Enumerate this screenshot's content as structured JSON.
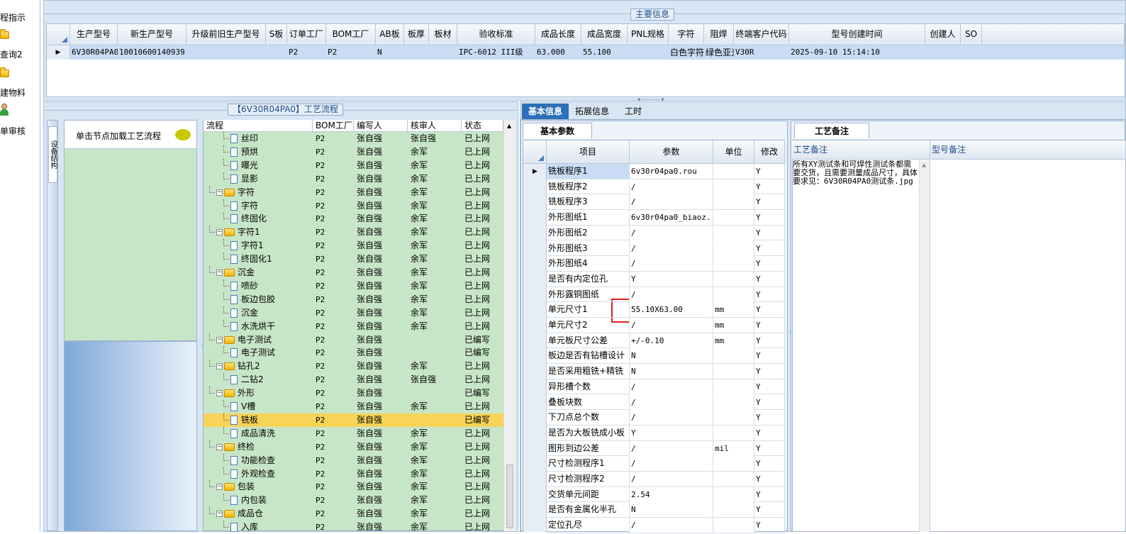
{
  "left_nav": [
    {
      "label": "程指示",
      "icon": "none"
    },
    {
      "label": "查询2",
      "icon": "folder-icon"
    },
    {
      "label": "建物料",
      "icon": "folder-icon"
    },
    {
      "label": "单审核",
      "icon": "user-icon"
    }
  ],
  "main_info": {
    "legend": "主要信息",
    "columns": [
      "生产型号",
      "新生产型号",
      "升级前旧生产型号",
      "S板",
      "订单工厂",
      "BOM工厂",
      "AB板",
      "板厚",
      "板材",
      "验收标准",
      "成品长度",
      "成品宽度",
      "PNL规格",
      "字符",
      "阻焊",
      "终端客户代码",
      "型号创建时间",
      "创建人",
      "SO"
    ],
    "row": [
      "6V30R04PA0",
      "10010600140939",
      "",
      "",
      "P2",
      "P2",
      "N",
      "",
      "",
      "IPC-6012 III级",
      "63.000",
      "55.100",
      "",
      "白色字符",
      "绿色亚光",
      "V30R",
      "2025-09-10 15:14:10",
      "",
      ""
    ]
  },
  "flow": {
    "legend": "【6V30R04PA0】工艺流程",
    "side_tab": "设备结构",
    "hint": "单击节点加载工艺流程",
    "columns": [
      "流程",
      "BOM工厂",
      "编写人",
      "核审人",
      "状态"
    ],
    "rows": [
      {
        "level": 2,
        "type": "file",
        "name": "丝印",
        "factory": "P2",
        "writer": "张自强",
        "reviewer": "张自强",
        "status": "已上网"
      },
      {
        "level": 2,
        "type": "file",
        "name": "预烘",
        "factory": "P2",
        "writer": "张自强",
        "reviewer": "余军",
        "status": "已上网"
      },
      {
        "level": 2,
        "type": "file",
        "name": "曝光",
        "factory": "P2",
        "writer": "张自强",
        "reviewer": "余军",
        "status": "已上网"
      },
      {
        "level": 2,
        "type": "file",
        "name": "显影",
        "factory": "P2",
        "writer": "张自强",
        "reviewer": "余军",
        "status": "已上网"
      },
      {
        "level": 1,
        "type": "folder",
        "name": "字符",
        "factory": "P2",
        "writer": "张自强",
        "reviewer": "余军",
        "status": "已上网"
      },
      {
        "level": 2,
        "type": "file",
        "name": "字符",
        "factory": "P2",
        "writer": "张自强",
        "reviewer": "余军",
        "status": "已上网"
      },
      {
        "level": 2,
        "type": "file",
        "name": "终固化",
        "factory": "P2",
        "writer": "张自强",
        "reviewer": "余军",
        "status": "已上网"
      },
      {
        "level": 1,
        "type": "folder",
        "name": "字符1",
        "factory": "P2",
        "writer": "张自强",
        "reviewer": "余军",
        "status": "已上网"
      },
      {
        "level": 2,
        "type": "file",
        "name": "字符1",
        "factory": "P2",
        "writer": "张自强",
        "reviewer": "余军",
        "status": "已上网"
      },
      {
        "level": 2,
        "type": "file",
        "name": "终固化1",
        "factory": "P2",
        "writer": "张自强",
        "reviewer": "余军",
        "status": "已上网"
      },
      {
        "level": 1,
        "type": "folder",
        "name": "沉金",
        "factory": "P2",
        "writer": "张自强",
        "reviewer": "余军",
        "status": "已上网"
      },
      {
        "level": 2,
        "type": "file",
        "name": "喷砂",
        "factory": "P2",
        "writer": "张自强",
        "reviewer": "余军",
        "status": "已上网"
      },
      {
        "level": 2,
        "type": "file",
        "name": "板边包胶",
        "factory": "P2",
        "writer": "张自强",
        "reviewer": "余军",
        "status": "已上网"
      },
      {
        "level": 2,
        "type": "file",
        "name": "沉金",
        "factory": "P2",
        "writer": "张自强",
        "reviewer": "余军",
        "status": "已上网"
      },
      {
        "level": 2,
        "type": "file",
        "name": "水洗烘干",
        "factory": "P2",
        "writer": "张自强",
        "reviewer": "余军",
        "status": "已上网"
      },
      {
        "level": 1,
        "type": "folder",
        "name": "电子测试",
        "factory": "P2",
        "writer": "张自强",
        "reviewer": "",
        "status": "已编写"
      },
      {
        "level": 2,
        "type": "file",
        "name": "电子测试",
        "factory": "P2",
        "writer": "张自强",
        "reviewer": "",
        "status": "已编写"
      },
      {
        "level": 1,
        "type": "folder",
        "name": "钻孔2",
        "factory": "P2",
        "writer": "张自强",
        "reviewer": "余军",
        "status": "已上网"
      },
      {
        "level": 2,
        "type": "file",
        "name": "二钻2",
        "factory": "P2",
        "writer": "张自强",
        "reviewer": "张自强",
        "status": "已上网"
      },
      {
        "level": 1,
        "type": "folder",
        "name": "外形",
        "factory": "P2",
        "writer": "张自强",
        "reviewer": "",
        "status": "已编写"
      },
      {
        "level": 2,
        "type": "file",
        "name": "V槽",
        "factory": "P2",
        "writer": "张自强",
        "reviewer": "余军",
        "status": "已上网"
      },
      {
        "level": 2,
        "type": "file",
        "name": "铣板",
        "factory": "P2",
        "writer": "张自强",
        "reviewer": "",
        "status": "已编写",
        "selected": true
      },
      {
        "level": 2,
        "type": "file",
        "name": "成品清洗",
        "factory": "P2",
        "writer": "张自强",
        "reviewer": "余军",
        "status": "已上网"
      },
      {
        "level": 1,
        "type": "folder",
        "name": "终检",
        "factory": "P2",
        "writer": "张自强",
        "reviewer": "余军",
        "status": "已上网"
      },
      {
        "level": 2,
        "type": "file",
        "name": "功能检查",
        "factory": "P2",
        "writer": "张自强",
        "reviewer": "余军",
        "status": "已上网"
      },
      {
        "level": 2,
        "type": "file",
        "name": "外观检查",
        "factory": "P2",
        "writer": "张自强",
        "reviewer": "余军",
        "status": "已上网"
      },
      {
        "level": 1,
        "type": "folder",
        "name": "包装",
        "factory": "P2",
        "writer": "张自强",
        "reviewer": "余军",
        "status": "已上网"
      },
      {
        "level": 2,
        "type": "file",
        "name": "内包装",
        "factory": "P2",
        "writer": "张自强",
        "reviewer": "余军",
        "status": "已上网"
      },
      {
        "level": 1,
        "type": "folder",
        "name": "成品仓",
        "factory": "P2",
        "writer": "张自强",
        "reviewer": "余军",
        "status": "已上网"
      },
      {
        "level": 2,
        "type": "file",
        "name": "入库",
        "factory": "P2",
        "writer": "张自强",
        "reviewer": "余军",
        "status": "已上网"
      }
    ]
  },
  "right": {
    "tabs": [
      "基本信息",
      "拓展信息",
      "工时"
    ],
    "subtab": "基本参数",
    "columns": [
      "项目",
      "参数",
      "单位",
      "修改"
    ],
    "rows": [
      {
        "item": "铣板程序1",
        "param": "6v30r04pa0.rou",
        "unit": "",
        "mod": "Y"
      },
      {
        "item": "铣板程序2",
        "param": "/",
        "unit": "",
        "mod": "Y"
      },
      {
        "item": "铣板程序3",
        "param": "/",
        "unit": "",
        "mod": "Y"
      },
      {
        "item": "外形图纸1",
        "param": "6v30r04pa0_biaoz...",
        "unit": "",
        "mod": "Y"
      },
      {
        "item": "外形图纸2",
        "param": "/",
        "unit": "",
        "mod": "Y"
      },
      {
        "item": "外形图纸3",
        "param": "/",
        "unit": "",
        "mod": "Y"
      },
      {
        "item": "外形图纸4",
        "param": "/",
        "unit": "",
        "mod": "Y"
      },
      {
        "item": "是否有内定位孔",
        "param": "Y",
        "unit": "",
        "mod": "Y"
      },
      {
        "item": "外形露铜图纸",
        "param": "/",
        "unit": "",
        "mod": "Y"
      },
      {
        "item": "单元尺寸1",
        "param": "55.10X63.00",
        "unit": "mm",
        "mod": "Y"
      },
      {
        "item": "单元尺寸2",
        "param": "/",
        "unit": "mm",
        "mod": "Y"
      },
      {
        "item": "单元板尺寸公差",
        "param": "+/-0.10",
        "unit": "mm",
        "mod": "Y"
      },
      {
        "item": "板边是否有钻槽设计",
        "param": "N",
        "unit": "",
        "mod": "Y"
      },
      {
        "item": "是否采用粗铣+精铣",
        "param": "N",
        "unit": "",
        "mod": "Y"
      },
      {
        "item": "异形槽个数",
        "param": "/",
        "unit": "",
        "mod": "Y"
      },
      {
        "item": "叠板块数",
        "param": "/",
        "unit": "",
        "mod": "Y"
      },
      {
        "item": "下刀点总个数",
        "param": "/",
        "unit": "",
        "mod": "Y"
      },
      {
        "item": "是否为大板铣成小板",
        "param": "Y",
        "unit": "",
        "mod": "Y"
      },
      {
        "item": "图形到边公差",
        "param": "/",
        "unit": "mil",
        "mod": "Y"
      },
      {
        "item": "尺寸检测程序1",
        "param": "/",
        "unit": "",
        "mod": "Y"
      },
      {
        "item": "尺寸检测程序2",
        "param": "/",
        "unit": "",
        "mod": "Y"
      },
      {
        "item": "交货单元间距",
        "param": "2.54",
        "unit": "",
        "mod": "Y"
      },
      {
        "item": "是否有金属化半孔",
        "param": "N",
        "unit": "",
        "mod": "Y"
      },
      {
        "item": "定位孔尽",
        "param": "/",
        "unit": "",
        "mod": "Y"
      }
    ],
    "note_tab": "工艺备注",
    "note_columns": [
      "工艺备注",
      "型号备注"
    ],
    "note_text": "所有XY测试条和可焊性测试条都需要交货，且需要测量成品尺寸，具体要求见：6V30R04PA0测试条.jpg",
    "highlight_color": "#e02020"
  }
}
